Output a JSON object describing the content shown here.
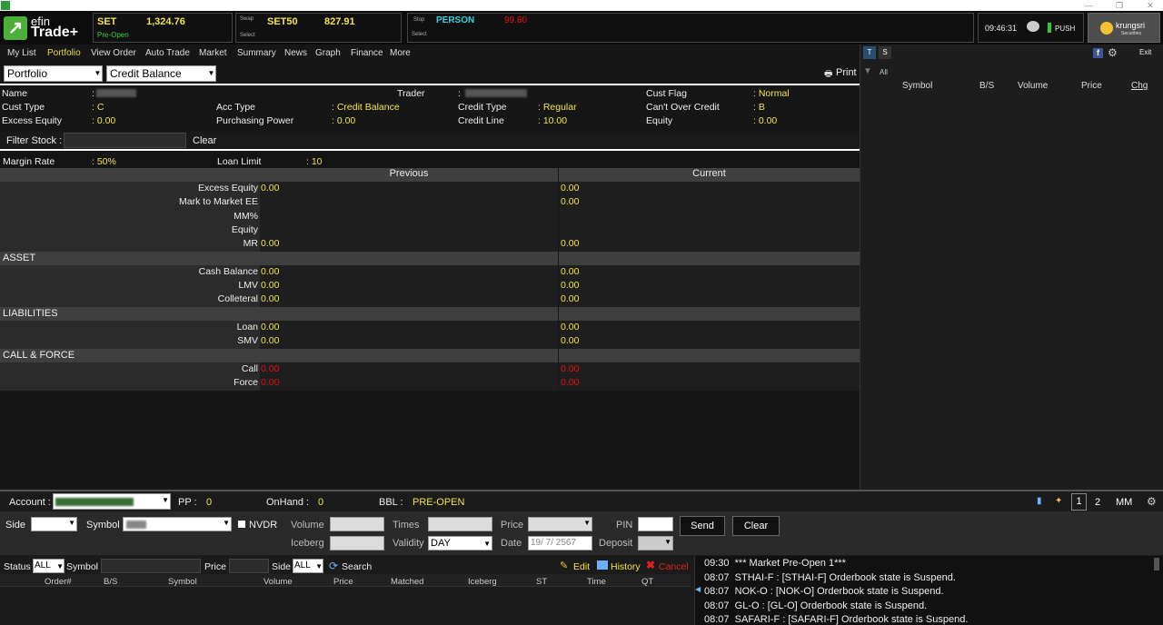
{
  "titlebar": {
    "controls": [
      "—",
      "❐",
      "✕"
    ]
  },
  "logo": {
    "line1": "efin",
    "line2": "Trade+"
  },
  "tickers": {
    "set": {
      "name": "SET",
      "value": "1,324.76",
      "status": "Pre-Open"
    },
    "swap": {
      "label": "Swap",
      "name": "SET50",
      "value": "827.91",
      "sub": "Select"
    },
    "stop": {
      "label": "Stop",
      "name": "PERSON",
      "value": "99.80",
      "sub": "Select"
    }
  },
  "clock": {
    "time": "09:46:31",
    "push": "PUSH"
  },
  "brand": {
    "name": "krungsri",
    "sub": "Securities"
  },
  "menu": [
    "My List",
    "Portfolio",
    "View Order",
    "Auto Trade",
    "Market",
    "Summary",
    "News",
    "Graph",
    "Finance",
    "More"
  ],
  "right_panel": {
    "tabs": [
      "T",
      "S"
    ],
    "exit": "Exit",
    "filter": "All",
    "columns": [
      "Symbol",
      "B/S",
      "Volume",
      "Price",
      "Chg"
    ]
  },
  "controls": {
    "view_select": "Portfolio",
    "mode_select": "Credit Balance",
    "print": "Print"
  },
  "info": {
    "name_label": "Name",
    "trader_label": "Trader",
    "cust_flag_label": "Cust Flag",
    "cust_flag": ": Normal",
    "cust_type_label": "Cust Type",
    "cust_type": ": C",
    "acc_type_label": "Acc Type",
    "acc_type": ": Credit Balance",
    "credit_type_label": "Credit Type",
    "credit_type": ": Regular",
    "cant_over_label": "Can't Over Credit",
    "cant_over": ": B",
    "excess_equity_label": "Excess Equity",
    "excess_equity": ": 0.00",
    "pp_label": "Purchasing Power",
    "pp": ": 0.00",
    "credit_line_label": "Credit Line",
    "credit_line": ": 10.00",
    "equity_label": "Equity",
    "equity": ": 0.00",
    "colon": ":"
  },
  "filter": {
    "label": "Filter Stock :",
    "clear": "Clear"
  },
  "margin": {
    "rate_label": "Margin Rate",
    "rate": ": 50%",
    "loan_label": "Loan Limit",
    "loan": ": 10"
  },
  "table": {
    "previous": "Previous",
    "current": "Current",
    "rows1": [
      {
        "label": "Excess Equity",
        "prev": "0.00",
        "cur": "0.00"
      },
      {
        "label": "Mark to Market EE",
        "prev": "",
        "cur": "0.00"
      },
      {
        "label": "MM%",
        "prev": "",
        "cur": ""
      },
      {
        "label": "Equity",
        "prev": "",
        "cur": ""
      },
      {
        "label": "MR",
        "prev": "0.00",
        "cur": "0.00"
      }
    ],
    "asset_title": "ASSET",
    "asset": [
      {
        "label": "Cash Balance",
        "prev": "0.00",
        "cur": "0.00"
      },
      {
        "label": "LMV",
        "prev": "0.00",
        "cur": "0.00"
      },
      {
        "label": "Colleteral",
        "prev": "0.00",
        "cur": "0.00"
      }
    ],
    "liab_title": "LIABILITIES",
    "liab": [
      {
        "label": "Loan",
        "prev": "0.00",
        "cur": "0.00"
      },
      {
        "label": "SMV",
        "prev": "0.00",
        "cur": "0.00"
      }
    ],
    "call_title": "CALL & FORCE",
    "call": [
      {
        "label": "Call",
        "prev": "0.00",
        "cur": "0.00"
      },
      {
        "label": "Force",
        "prev": "0.00",
        "cur": "0.00"
      }
    ]
  },
  "bottom": {
    "account_label": "Account :",
    "pp_label": "PP :",
    "pp": "0",
    "onhand_label": "OnHand :",
    "onhand": "0",
    "bbl_label": "BBL :",
    "bbl": "PRE-OPEN",
    "pages": [
      "1",
      "2"
    ],
    "mm": "MM",
    "side": "Side",
    "symbol": "Symbol",
    "nvdr": "NVDR",
    "volume": "Volume",
    "iceberg": "Iceberg",
    "times": "Times",
    "validity": "Validity",
    "validity_value": "DAY",
    "price": "Price",
    "date": "Date",
    "date_value": "19/ 7/ 2567",
    "pin": "PIN",
    "deposit": "Deposit",
    "send": "Send",
    "clear": "Clear",
    "status": "Status",
    "status_value": "ALL",
    "symbol2": "Symbol",
    "price2": "Price",
    "side2": "Side",
    "side_value": "ALL",
    "search": "Search",
    "edit": "Edit",
    "history": "History",
    "cancel": "Cancel",
    "order_cols": [
      "Order#",
      "B/S",
      "Symbol",
      "Volume",
      "Price",
      "Matched",
      "Iceberg",
      "ST",
      "Time",
      "QT"
    ]
  },
  "messages": [
    {
      "time": "09:30",
      "text": "*** Market Pre-Open 1***"
    },
    {
      "time": "08:07",
      "text": "STHAI-F : [STHAI-F] Orderbook state is Suspend."
    },
    {
      "time": "08:07",
      "text": "NOK-O : [NOK-O] Orderbook state is Suspend."
    },
    {
      "time": "08:07",
      "text": "GL-O : [GL-O] Orderbook state is Suspend."
    },
    {
      "time": "08:07",
      "text": "SAFARI-F : [SAFARI-F] Orderbook state is Suspend."
    }
  ]
}
